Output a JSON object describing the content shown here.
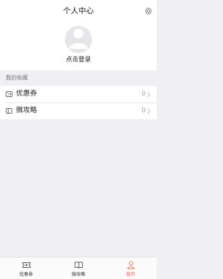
{
  "header": {
    "title": "个人中心",
    "settings_icon": "gear-icon"
  },
  "profile": {
    "avatar_icon": "user-avatar-icon",
    "login_label": "点击登录"
  },
  "favorites": {
    "section_title": "我的收藏",
    "items": [
      {
        "icon": "coupon-icon",
        "label": "优惠券",
        "count": "0"
      },
      {
        "icon": "book-icon",
        "label": "微攻略",
        "count": "0"
      }
    ]
  },
  "tabbar": {
    "tabs": [
      {
        "icon": "coupon-tab-icon",
        "label": "优惠券",
        "active": false
      },
      {
        "icon": "book-tab-icon",
        "label": "微攻略",
        "active": false
      },
      {
        "icon": "person-tab-icon",
        "label": "我的",
        "active": true
      }
    ],
    "active_color": "#f0664f"
  }
}
